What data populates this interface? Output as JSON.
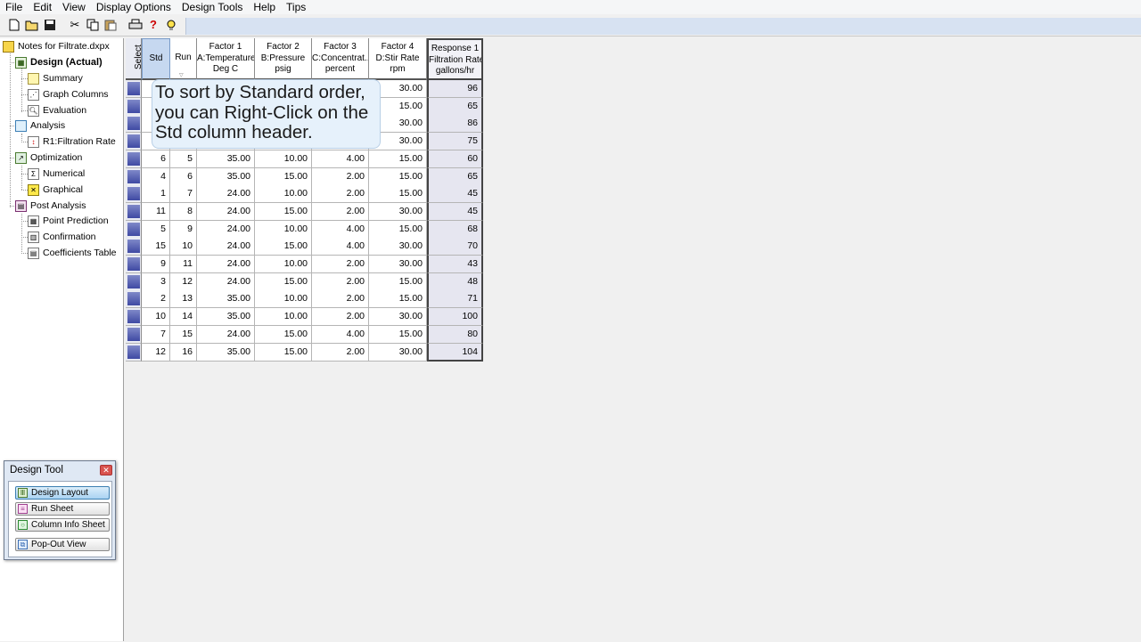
{
  "menu": [
    "File",
    "Edit",
    "View",
    "Display Options",
    "Design Tools",
    "Help",
    "Tips"
  ],
  "toolbar": {
    "icons": [
      "new-file-icon",
      "open-folder-icon",
      "save-icon",
      "cut-icon",
      "copy-icon",
      "paste-icon",
      "print-icon",
      "help-icon",
      "tip-lightbulb-icon"
    ]
  },
  "tree": {
    "root": "Notes for Filtrate.dxpx",
    "design": "Design (Actual)",
    "summary": "Summary",
    "graph_columns": "Graph Columns",
    "evaluation": "Evaluation",
    "analysis": "Analysis",
    "r1": "R1:Filtration Rate",
    "optimization": "Optimization",
    "numerical": "Numerical",
    "graphical": "Graphical",
    "post_analysis": "Post Analysis",
    "point_prediction": "Point Prediction",
    "confirmation": "Confirmation",
    "coefficients_table": "Coefficients Table"
  },
  "grid": {
    "headers": {
      "select": "Select",
      "std": "Std",
      "run": "Run",
      "f1_line1": "Factor 1",
      "f1_line2": "A:Temperature",
      "f1_line3": "Deg C",
      "f2_line1": "Factor 2",
      "f2_line2": "B:Pressure",
      "f2_line3": "psig",
      "f3_line1": "Factor 3",
      "f3_line2": "C:Concentrat...",
      "f3_line3": "percent",
      "f4_line1": "Factor 4",
      "f4_line2": "D:Stir Rate",
      "f4_line3": "rpm",
      "r1_line1": "Response 1",
      "r1_line2": "Filtration Rate",
      "r1_line3": "gallons/hr"
    },
    "rows": [
      {
        "std": "",
        "run": "",
        "a": "",
        "b": "",
        "c": "",
        "d": "30.00",
        "r": "96"
      },
      {
        "std": "",
        "run": "",
        "a": "",
        "b": "",
        "c": "",
        "d": "15.00",
        "r": "65"
      },
      {
        "std": "",
        "run": "",
        "a": "",
        "b": "",
        "c": "",
        "d": "30.00",
        "r": "86"
      },
      {
        "std": "",
        "run": "",
        "a": "",
        "b": "",
        "c": "",
        "d": "30.00",
        "r": "75"
      },
      {
        "std": "6",
        "run": "5",
        "a": "35.00",
        "b": "10.00",
        "c": "4.00",
        "d": "15.00",
        "r": "60"
      },
      {
        "std": "4",
        "run": "6",
        "a": "35.00",
        "b": "15.00",
        "c": "2.00",
        "d": "15.00",
        "r": "65"
      },
      {
        "std": "1",
        "run": "7",
        "a": "24.00",
        "b": "10.00",
        "c": "2.00",
        "d": "15.00",
        "r": "45"
      },
      {
        "std": "11",
        "run": "8",
        "a": "24.00",
        "b": "15.00",
        "c": "2.00",
        "d": "30.00",
        "r": "45"
      },
      {
        "std": "5",
        "run": "9",
        "a": "24.00",
        "b": "10.00",
        "c": "4.00",
        "d": "15.00",
        "r": "68"
      },
      {
        "std": "15",
        "run": "10",
        "a": "24.00",
        "b": "15.00",
        "c": "4.00",
        "d": "30.00",
        "r": "70"
      },
      {
        "std": "9",
        "run": "11",
        "a": "24.00",
        "b": "10.00",
        "c": "2.00",
        "d": "30.00",
        "r": "43"
      },
      {
        "std": "3",
        "run": "12",
        "a": "24.00",
        "b": "15.00",
        "c": "2.00",
        "d": "15.00",
        "r": "48"
      },
      {
        "std": "2",
        "run": "13",
        "a": "35.00",
        "b": "10.00",
        "c": "2.00",
        "d": "15.00",
        "r": "71"
      },
      {
        "std": "10",
        "run": "14",
        "a": "35.00",
        "b": "10.00",
        "c": "2.00",
        "d": "30.00",
        "r": "100"
      },
      {
        "std": "7",
        "run": "15",
        "a": "24.00",
        "b": "15.00",
        "c": "4.00",
        "d": "15.00",
        "r": "80"
      },
      {
        "std": "12",
        "run": "16",
        "a": "35.00",
        "b": "15.00",
        "c": "2.00",
        "d": "30.00",
        "r": "104"
      }
    ]
  },
  "tooltip": {
    "line1": "To sort by Standard order,",
    "line2": "you can Right-Click on the",
    "line3": "Std column header."
  },
  "design_tool": {
    "title": "Design Tool",
    "buttons": [
      "Design Layout",
      "Run Sheet",
      "Column Info Sheet",
      "Pop-Out View"
    ]
  },
  "colors": {
    "selection_swatch": "#3f4aa3",
    "std_header_highlight": "#c6d8f0",
    "response_column": "#e6e6f0",
    "tooltip_bg": "#e6f1fb"
  }
}
